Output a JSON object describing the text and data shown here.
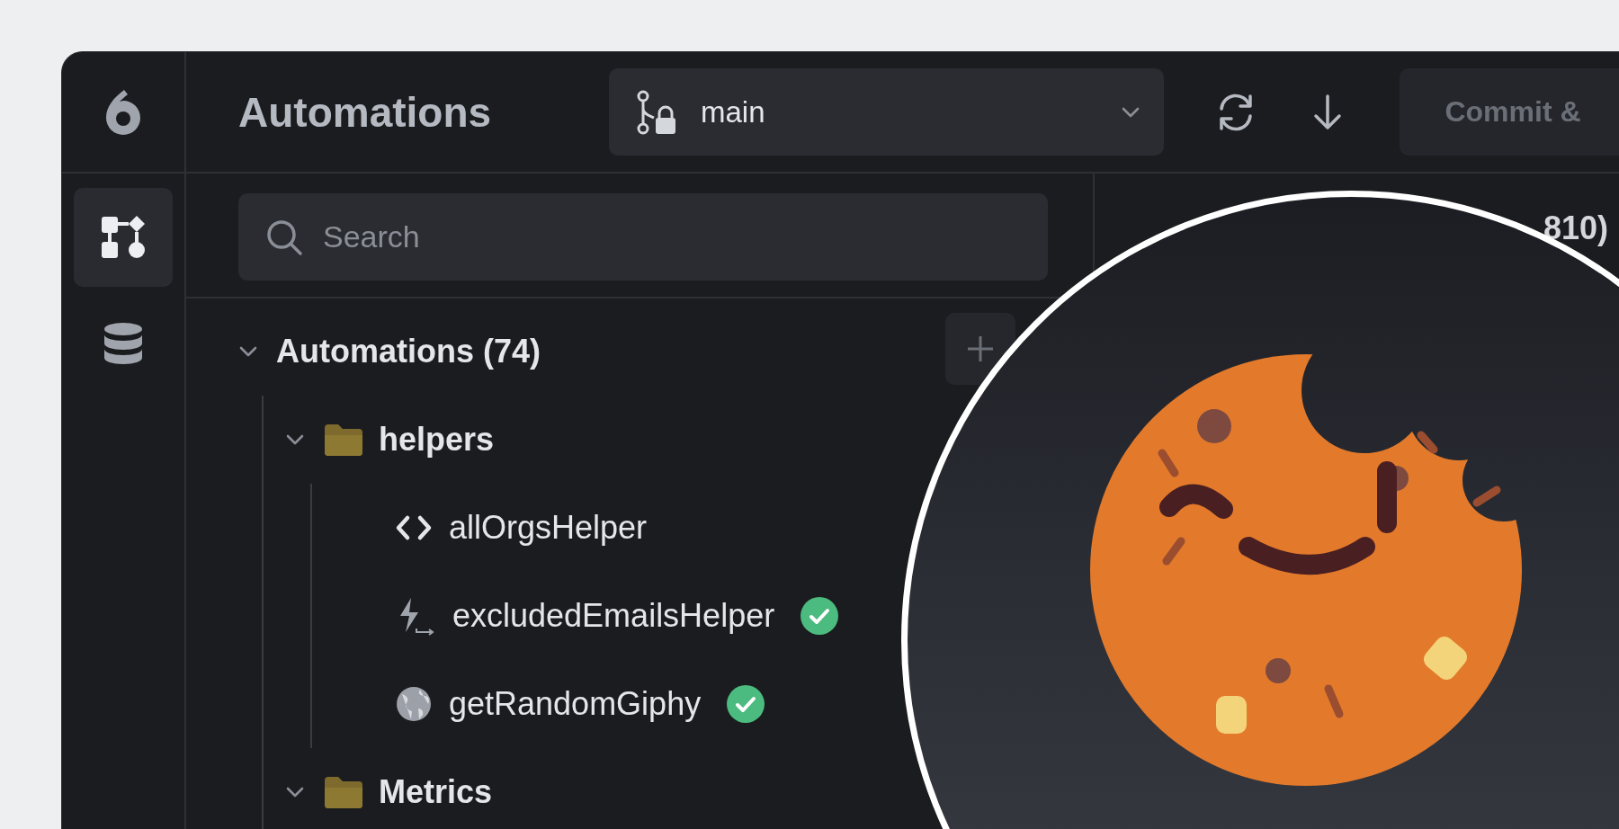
{
  "app": {
    "title": "Automations"
  },
  "branch": {
    "name": "main"
  },
  "toolbar": {
    "commit_button": "Commit &"
  },
  "rail": [
    {
      "kind": "workflow",
      "selected": true
    },
    {
      "kind": "database",
      "selected": false
    }
  ],
  "search": {
    "placeholder": "Search"
  },
  "tree": {
    "label": "Automations (74)",
    "expanded": true,
    "children": [
      {
        "kind": "folder",
        "label": "helpers",
        "expanded": true,
        "children": [
          {
            "kind": "script",
            "label": "allOrgsHelper",
            "deployed": false
          },
          {
            "kind": "trigger",
            "label": "excludedEmailsHelper",
            "deployed": true
          },
          {
            "kind": "web",
            "label": "getRandomGiphy",
            "deployed": true
          }
        ]
      },
      {
        "kind": "folder",
        "label": "Metrics",
        "expanded": true
      }
    ]
  },
  "right_panel": {
    "heading_fragment": "810)"
  }
}
